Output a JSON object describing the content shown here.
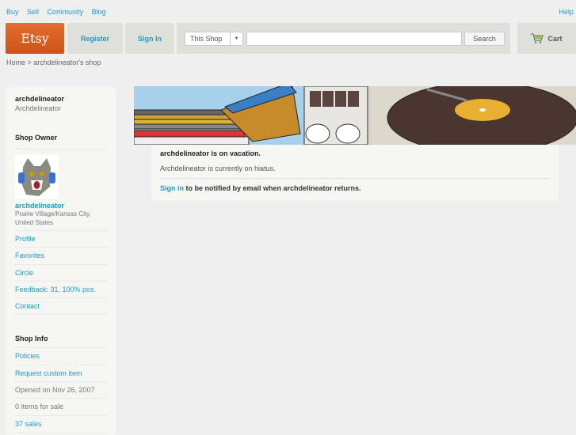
{
  "topnav": {
    "items": [
      "Buy",
      "Sell",
      "Community",
      "Blog"
    ],
    "help": "Help"
  },
  "header": {
    "logo": "Etsy",
    "register": "Register",
    "signin": "Sign In",
    "scope": "This Shop",
    "search_value": "",
    "search_button": "Search",
    "cart": "Cart"
  },
  "breadcrumb": "Home > archdelineator's shop",
  "sidebar": {
    "shop_name": "archdelineator",
    "shop_title": "Archdelineator",
    "owner_heading": "Shop Owner",
    "owner_name": "archdelineator",
    "location": "Prairie Village/Kansas City, United States",
    "owner_links": [
      "Profile",
      "Favorites",
      "Circle",
      "Feedback: 31, 100% pos.",
      "Contact"
    ],
    "info_heading": "Shop Info",
    "info_links": [
      "Policies",
      "Request custom item"
    ],
    "opened": "Opened on Nov 26, 2007",
    "items": "0 items for sale",
    "sales": "37 sales"
  },
  "notice": {
    "title": "archdelineator is on vacation.",
    "message": "Archdelineator is currently on hiatus.",
    "signin": "Sign in",
    "signin_rest": " to be notified by email when archdelineator returns."
  }
}
